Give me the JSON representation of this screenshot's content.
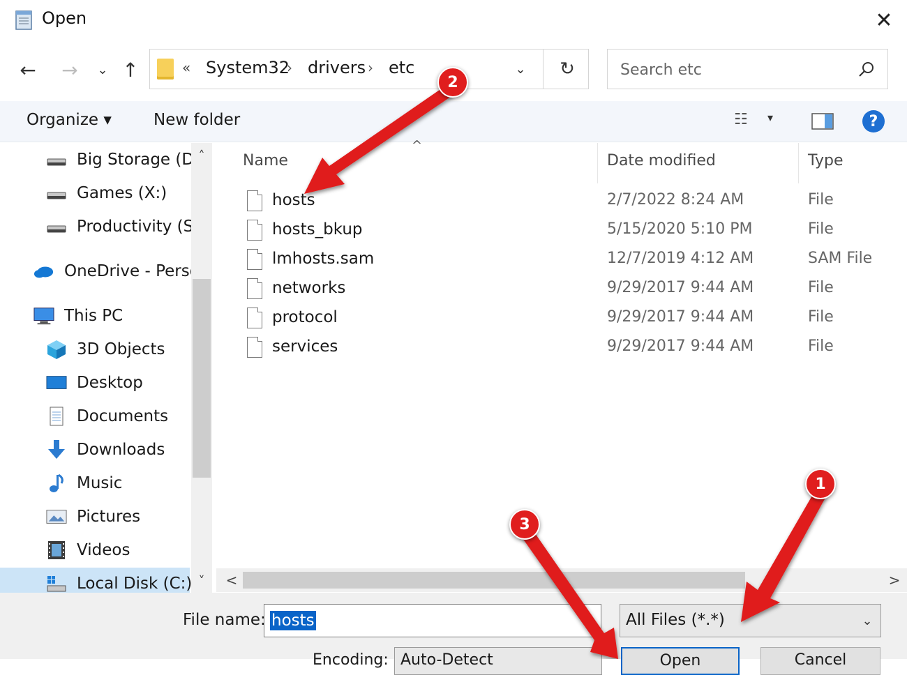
{
  "window": {
    "title": "Open",
    "close_glyph": "✕"
  },
  "nav": {
    "back_glyph": "←",
    "forward_glyph": "→",
    "recent_glyph": "⌄",
    "up_glyph": "↑"
  },
  "address": {
    "overflow_glyph": "«",
    "crumbs": [
      "System32",
      "drivers",
      "etc"
    ],
    "separator": "›",
    "dropdown_glyph": "⌄",
    "refresh_glyph": "↻"
  },
  "search": {
    "placeholder": "Search etc",
    "icon_glyph": "⌕"
  },
  "toolbar": {
    "organize_label": "Organize ▾",
    "new_folder_label": "New folder",
    "view_glyph": "☷",
    "view_dropdown_glyph": "▾",
    "help_glyph": "?"
  },
  "nav_pane": {
    "items": [
      {
        "label": "Big Storage (D:)",
        "icon": "drive-icon"
      },
      {
        "label": "Games (X:)",
        "icon": "drive-icon"
      },
      {
        "label": "Productivity (S:)",
        "icon": "drive-icon"
      },
      {
        "label": "OneDrive - Perso",
        "icon": "cloud-icon"
      },
      {
        "label": "This PC",
        "icon": "computer-icon"
      },
      {
        "label": "3D Objects",
        "icon": "cube-icon"
      },
      {
        "label": "Desktop",
        "icon": "desktop-icon"
      },
      {
        "label": "Documents",
        "icon": "document-icon"
      },
      {
        "label": "Downloads",
        "icon": "download-icon"
      },
      {
        "label": "Music",
        "icon": "music-icon"
      },
      {
        "label": "Pictures",
        "icon": "picture-icon"
      },
      {
        "label": "Videos",
        "icon": "video-icon"
      },
      {
        "label": "Local Disk (C:)",
        "icon": "system-drive-icon"
      }
    ],
    "scroll_up_glyph": "˄",
    "scroll_down_glyph": "˅"
  },
  "file_list": {
    "sort_caret": "^",
    "columns": [
      "Name",
      "Date modified",
      "Type"
    ],
    "rows": [
      {
        "name": "hosts",
        "date": "2/7/2022 8:24 AM",
        "type": "File"
      },
      {
        "name": "hosts_bkup",
        "date": "5/15/2020 5:10 PM",
        "type": "File"
      },
      {
        "name": "lmhosts.sam",
        "date": "12/7/2019 4:12 AM",
        "type": "SAM File"
      },
      {
        "name": "networks",
        "date": "9/29/2017 9:44 AM",
        "type": "File"
      },
      {
        "name": "protocol",
        "date": "9/29/2017 9:44 AM",
        "type": "File"
      },
      {
        "name": "services",
        "date": "9/29/2017 9:44 AM",
        "type": "File"
      }
    ],
    "scroll_left_glyph": "<",
    "scroll_right_glyph": ">"
  },
  "bottom": {
    "file_name_label": "File name:",
    "file_name_value": "hosts",
    "file_type_value": "All Files  (*.*)",
    "encoding_label": "Encoding:",
    "encoding_value": "Auto-Detect",
    "open_label": "Open",
    "cancel_label": "Cancel",
    "dropdown_glyph": "⌄"
  },
  "annotations": {
    "badges": [
      "2",
      "1",
      "3"
    ],
    "color": "#e01e1e"
  },
  "colors": {
    "accent": "#0a64c8",
    "help": "#1e6fd2",
    "folder": "#f7d05a",
    "selection": "#cce4f7"
  }
}
